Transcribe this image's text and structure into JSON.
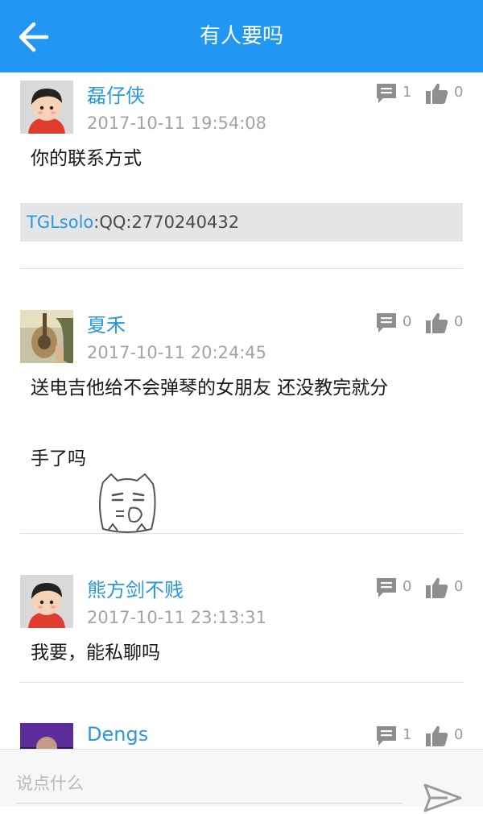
{
  "header": {
    "title": "有人要吗",
    "back_icon": "arrow-left-icon",
    "background": "#2196f3"
  },
  "comments": [
    {
      "name": "磊仔侠",
      "time": "2017-10-11 19:54:08",
      "comment_count": "1",
      "like_count": "0",
      "content": "你的联系方式",
      "reply": {
        "user": "TGLsolo",
        "text": ":QQ:2770240432"
      }
    },
    {
      "name": "夏禾",
      "time": "2017-10-11 20:24:45",
      "comment_count": "0",
      "like_count": "0",
      "content_line1": "送电吉他给不会弹琴的女朋友 还没教完就分",
      "content_line2": "手了吗",
      "sticker": "thinking-cat-face-sticker"
    },
    {
      "name": "熊方剑不贱",
      "time": "2017-10-11 23:13:31",
      "comment_count": "0",
      "like_count": "0",
      "content": "我要，能私聊吗"
    },
    {
      "name": "Dengs",
      "comment_count": "1",
      "like_count": "0"
    }
  ],
  "footer": {
    "placeholder": "说点什么",
    "send_icon": "send-icon"
  },
  "colors": {
    "accent": "#2196f3",
    "username": "#2a98dc",
    "muted": "#a3a3a3"
  }
}
